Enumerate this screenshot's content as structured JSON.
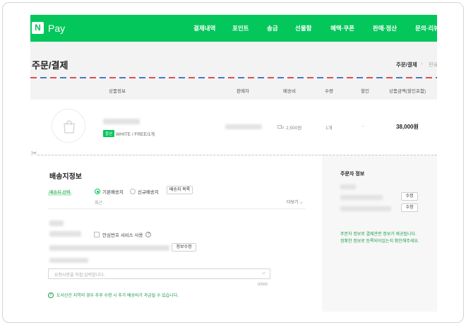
{
  "header": {
    "logo_letter": "N",
    "logo_text": "Pay",
    "nav": [
      "결제내역",
      "포인트",
      "송금",
      "선물함",
      "혜택·쿠폰",
      "판매·정산",
      "문의·리뷰"
    ]
  },
  "page": {
    "title": "주문/결제",
    "breadcrumb_current": "주문/결제",
    "breadcrumb_next": "완료"
  },
  "table": {
    "columns": [
      "상품정보",
      "판매자",
      "배송비",
      "수량",
      "할인",
      "상품금액(할인포함)"
    ],
    "row": {
      "badge": "옵션",
      "option": "WHITE / FREE/1개",
      "shipping_fee": "2,500원",
      "quantity": "1개",
      "discount": "-",
      "amount": "38,000원"
    }
  },
  "shipping": {
    "title": "배송지정보",
    "select_label": "배송지 선택",
    "radio_default": "기본배송지",
    "radio_new": "신규배송지",
    "list_button": "배송지 목록",
    "recent": "최근:",
    "more": "더보기 ⌵",
    "safe_number": "안심번호 서비스 사용",
    "help": "?",
    "edit_info_button": "정보수정",
    "request_placeholder": "요청사항을 직접 입력합니다.",
    "counter": "0/500",
    "notice_icon": "!",
    "notice": "도서산간 지역의 경우 추후 수령 시 추가 배송비가 과금될 수 있습니다."
  },
  "orderer": {
    "title": "주문자 정보",
    "edit_button": "수정",
    "note_line1": "주문자 정보로 결제관련 정보가 제공됩니다.",
    "note_line2": "정확한 정보로 등록되어있는지 확인해주세요."
  },
  "colors": {
    "brand_green": "#03c75a",
    "notice_green": "#1d9c4b"
  },
  "icons": {
    "scissors": "✂",
    "shipping": "truck-icon",
    "product": "shopping-bag-icon"
  }
}
